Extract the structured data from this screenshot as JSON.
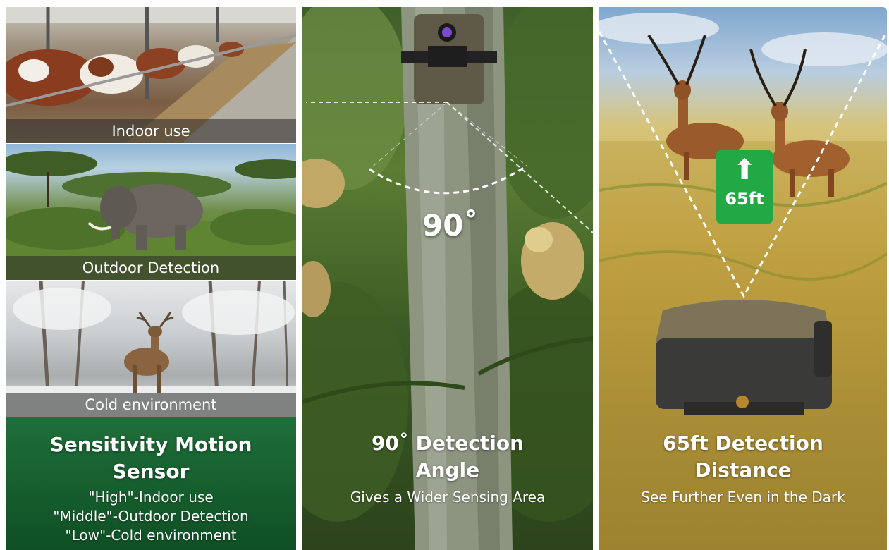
{
  "panel1": {
    "captions": [
      "Indoor use",
      "Outdoor Detection",
      "Cold environment"
    ],
    "title_lines": [
      "Sensitivity Motion",
      "Sensor"
    ],
    "sub_lines": [
      "\"High\"-Indoor use",
      "\"Middle\"-Outdoor Detection",
      "\"Low\"-Cold environment"
    ]
  },
  "panel2": {
    "angle_label": "90˚",
    "title_lines": [
      "90˚ Detection",
      "Angle"
    ],
    "sub": "Gives a Wider Sensing Area"
  },
  "panel3": {
    "badge_value": "65ft",
    "title_lines": [
      "65ft Detection",
      "Distance"
    ],
    "sub": "See Further Even in the Dark"
  },
  "colors": {
    "badge_green": "#22a845",
    "panel1_bottom": "#17612f",
    "caption_bar": "#282828"
  }
}
